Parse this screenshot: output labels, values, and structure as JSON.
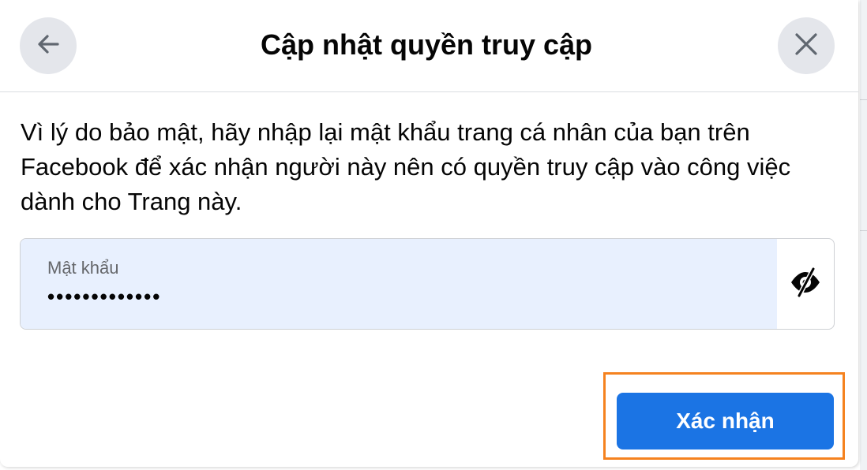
{
  "dialog": {
    "title": "Cập nhật quyền truy cập",
    "description": "Vì lý do bảo mật, hãy nhập lại mật khẩu trang cá nhân của bạn trên Facebook để xác nhận người này nên có quyền truy cập vào công việc dành cho Trang này."
  },
  "password_field": {
    "label": "Mật khẩu",
    "masked_value": "•••••••••••••"
  },
  "actions": {
    "confirm_label": "Xác nhận"
  },
  "icons": {
    "back": "arrow-left-icon",
    "close": "close-icon",
    "visibility": "eye-slash-icon"
  },
  "colors": {
    "primary": "#1b74e4",
    "highlight": "#f5821f",
    "field_fill": "#e8f0fe",
    "icon_button_bg": "#e4e6eb"
  }
}
